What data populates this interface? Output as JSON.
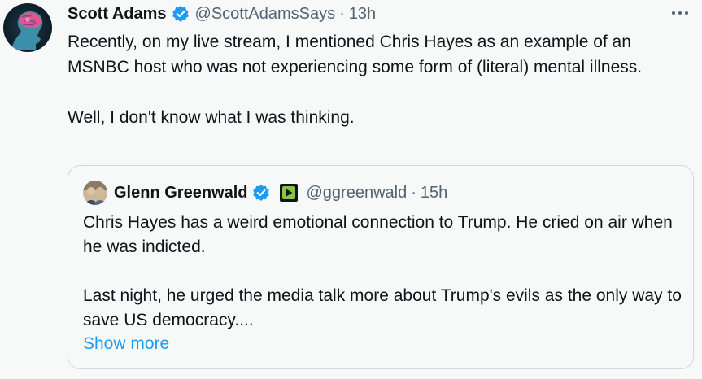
{
  "tweet": {
    "author_name": "Scott Adams",
    "handle": "@ScottAdamsSays",
    "separator": "·",
    "time": "13h",
    "more_icon": "more-horizontal-icon",
    "verified_color": "#1d9bf0",
    "paragraph_1": "Recently, on my live stream, I mentioned Chris Hayes as an example of an MSNBC host who was not experiencing some form of (literal) mental illness.",
    "paragraph_2": "Well, I don't know what I was thinking."
  },
  "quote": {
    "author_name": "Glenn Greenwald",
    "badge_icon": "rumble-icon",
    "handle": "@ggreenwald",
    "separator": "·",
    "time": "15h",
    "paragraph_1": "Chris Hayes has a weird emotional connection to Trump. He cried on air when he was indicted.",
    "paragraph_2": "Last night, he urged the media talk more about Trump's evils as the only way to save US democracy....",
    "show_more": "Show more"
  },
  "colors": {
    "text": "#0f1419",
    "secondary": "#536471",
    "link": "#1d9bf0",
    "border": "#cfd9de",
    "badge_green": "#85c742"
  }
}
